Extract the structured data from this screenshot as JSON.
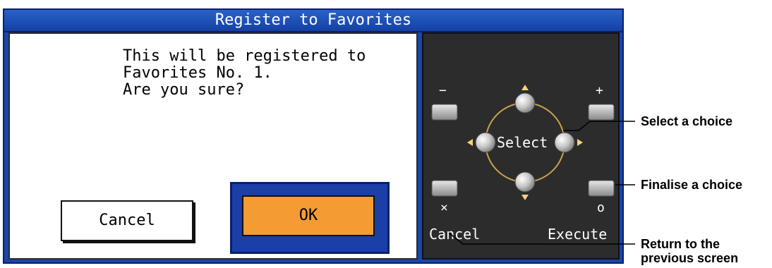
{
  "window": {
    "title": "Register to Favorites"
  },
  "dialog": {
    "message": "This will be registered to\nFavorites No. 1.\nAre you sure?",
    "cancel_label": "Cancel",
    "ok_label": "OK"
  },
  "panel": {
    "minus": "−",
    "plus": "+",
    "select_label": "Select",
    "cancel_symbol": "×",
    "execute_symbol": "o",
    "cancel_label": "Cancel",
    "execute_label": "Execute"
  },
  "annotations": {
    "select_choice": "Select a choice",
    "finalise_choice": "Finalise a choice",
    "return_line1": "Return to the",
    "return_line2": "previous screen"
  },
  "colors": {
    "accent_blue": "#1b46a8",
    "ok_orange": "#f59b33",
    "panel_dark": "#2c2c2c"
  }
}
